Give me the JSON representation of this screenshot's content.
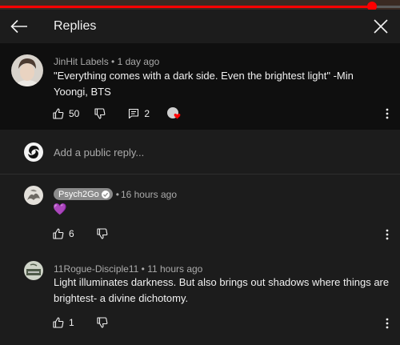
{
  "player": {
    "progress": 0.93
  },
  "header": {
    "title": "Replies",
    "back_icon": "arrow-left-icon",
    "close_icon": "close-icon"
  },
  "parent_comment": {
    "author": "JinHit Labels",
    "time": "1 day ago",
    "text": "\"Everything comes with a dark side. Even the brightest light\" -Min Yoongi, BTS",
    "likes": "50",
    "replies": "2"
  },
  "add_reply": {
    "placeholder": "Add a public reply..."
  },
  "replies": [
    {
      "author": "Psych2Go",
      "time": "16 hours ago",
      "text": "💜",
      "likes": "6",
      "verified": true
    },
    {
      "author": "11Rogue-Disciple11",
      "time": "11 hours ago",
      "text": "Light illuminates darkness. But also brings out shadows where things are brightest- a divine dichotomy.",
      "likes": "1"
    }
  ],
  "colors": {
    "accent": "#ff0000",
    "background": "#1c1c1c",
    "parent_background": "#0f0f0f",
    "secondary_text": "#aaaaaa"
  }
}
